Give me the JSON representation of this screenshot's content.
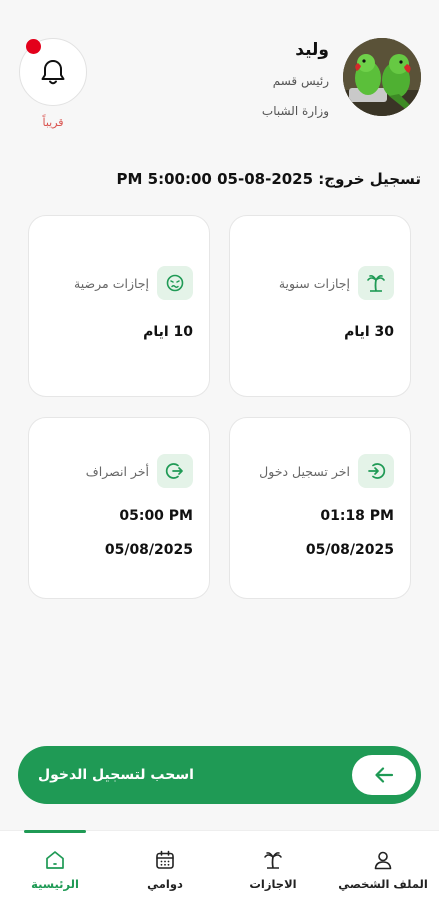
{
  "profile": {
    "name": "وليد",
    "role": "رئيس قسم",
    "department": "وزارة الشباب",
    "avatar_icon": "parrot-photo"
  },
  "notifications": {
    "icon": "bell-icon",
    "caption": "قريباً",
    "dot_color": "#e3001b"
  },
  "checkout": {
    "text": "تسجيل خروج: 2025-08-05 5:00:00 PM"
  },
  "cards": {
    "annual": {
      "label": "إجازات سنوية",
      "value": "30 ايام",
      "icon": "palm-tree-icon"
    },
    "sick": {
      "label": "إجازات مرضية",
      "value": "10 ايام",
      "icon": "sick-face-icon"
    },
    "last_checkin": {
      "label": "اخر تسجيل دخول",
      "time": "01:18 PM",
      "date": "05/08/2025",
      "icon": "login-icon"
    },
    "last_checkout": {
      "label": "أخر انصراف",
      "time": "05:00 PM",
      "date": "05/08/2025",
      "icon": "logout-icon"
    }
  },
  "swipe": {
    "label": "اسحب لتسجيل الدخول",
    "icon": "arrow-left-icon"
  },
  "tabs": {
    "profile": {
      "label": "الملف الشخصي",
      "icon": "user-icon"
    },
    "leaves": {
      "label": "الاجازات",
      "icon": "palm-tree-icon"
    },
    "attendance": {
      "label": "دوامي",
      "icon": "calendar-icon"
    },
    "home": {
      "label": "الرئيسية",
      "icon": "home-icon",
      "active": true
    }
  },
  "colors": {
    "accent": "#1f9a55",
    "accent_light": "#e4f3e8",
    "alert": "#d9534f"
  }
}
